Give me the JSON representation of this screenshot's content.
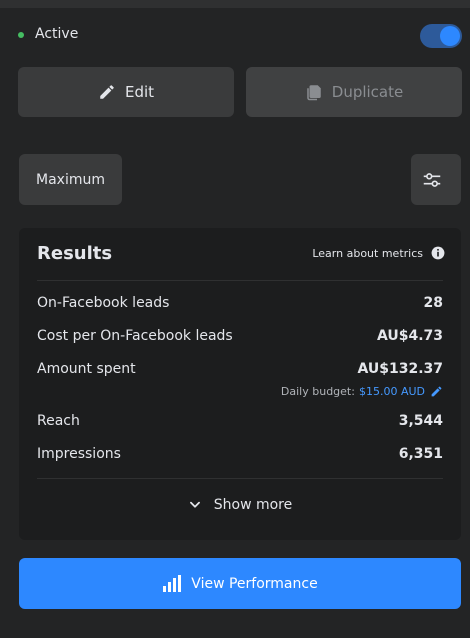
{
  "status": {
    "label": "Active",
    "toggle_on": true
  },
  "actions": {
    "edit_label": "Edit",
    "duplicate_label": "Duplicate"
  },
  "bid_strategy": {
    "label": "Maximum"
  },
  "results": {
    "title": "Results",
    "learn_link": "Learn about metrics",
    "metrics": [
      {
        "label": "On-Facebook leads",
        "value": "28"
      },
      {
        "label": "Cost per On-Facebook leads",
        "value": "AU$4.73"
      },
      {
        "label": "Amount spent",
        "value": "AU$132.37"
      },
      {
        "label": "Reach",
        "value": "3,544"
      },
      {
        "label": "Impressions",
        "value": "6,351"
      }
    ],
    "budget": {
      "label": "Daily budget:",
      "value": "$15.00 AUD"
    },
    "show_more": "Show more"
  },
  "performance_button": "View Performance",
  "colors": {
    "accent": "#2d88ff",
    "link": "#4599ff",
    "status": "#45bd62"
  },
  "icons": [
    "pencil-icon",
    "copy-icon",
    "sliders-icon",
    "info-icon",
    "chevron-down-icon",
    "bar-chart-icon"
  ]
}
